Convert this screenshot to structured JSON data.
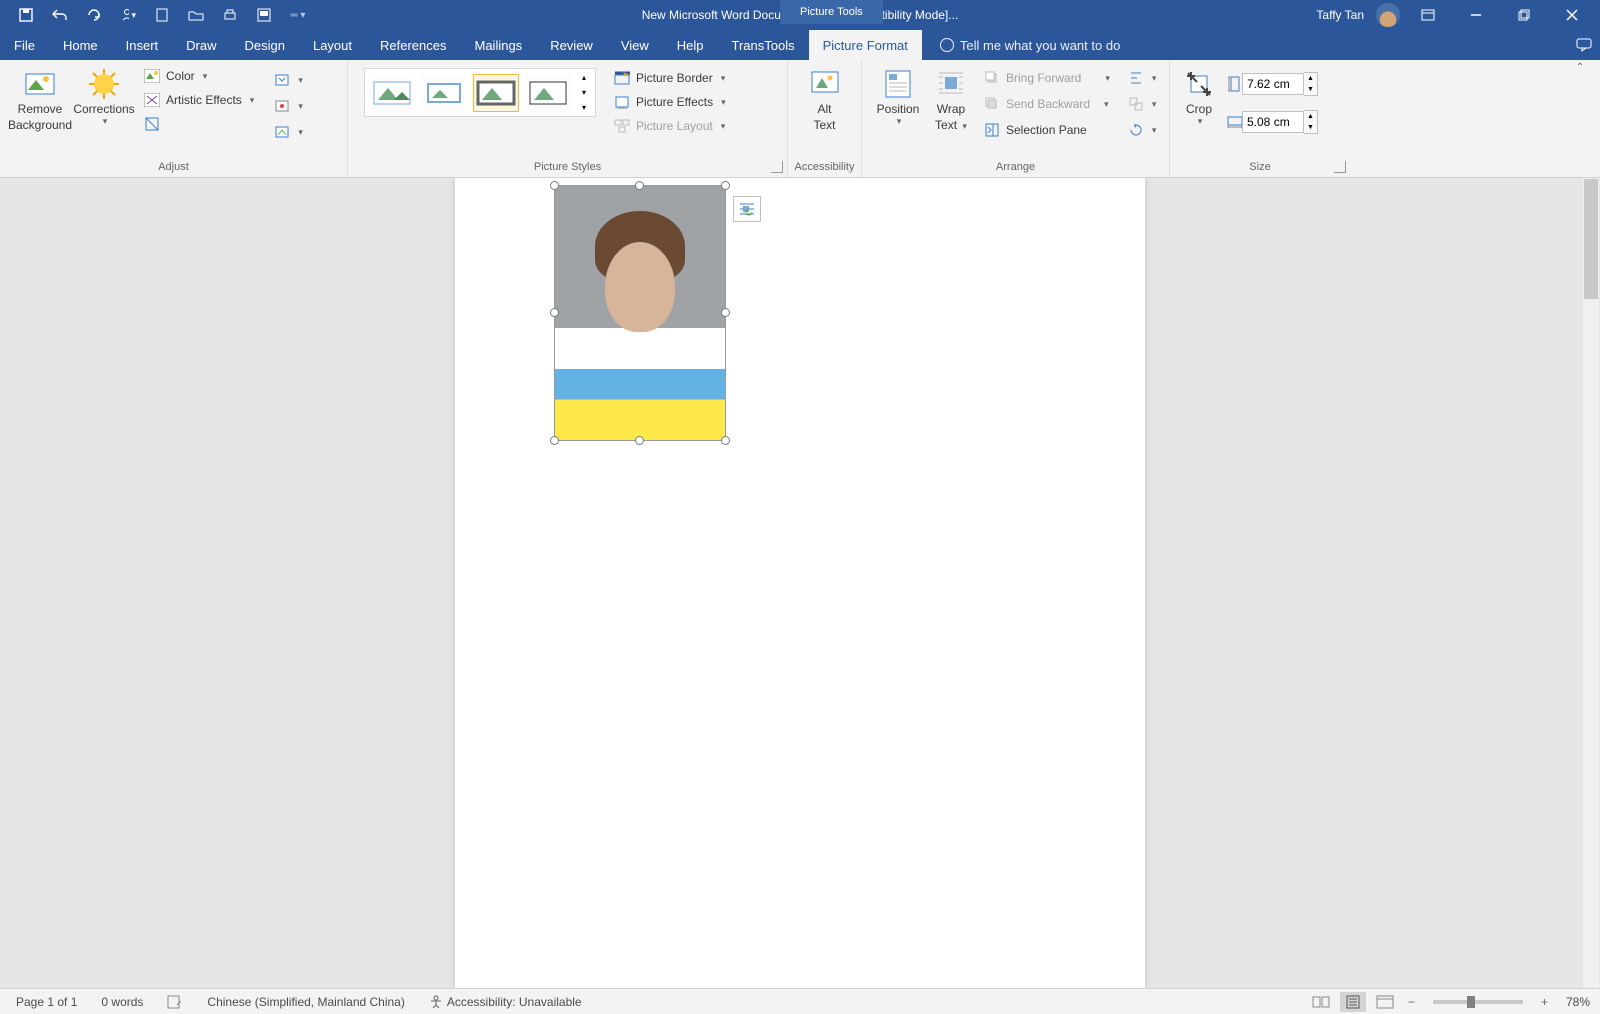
{
  "title_bar": {
    "document_title": "New Microsoft Word Document.docx [Compatibility Mode]...",
    "context_tab": "Picture Tools",
    "user_name": "Taffy Tan"
  },
  "tabs": {
    "file": "File",
    "home": "Home",
    "insert": "Insert",
    "draw": "Draw",
    "design": "Design",
    "layout": "Layout",
    "references": "References",
    "mailings": "Mailings",
    "review": "Review",
    "view": "View",
    "help": "Help",
    "transtools": "TransTools",
    "picture_format": "Picture Format",
    "tellme": "Tell me what you want to do"
  },
  "ribbon": {
    "remove_bg1": "Remove",
    "remove_bg2": "Background",
    "corrections": "Corrections",
    "color": "Color",
    "artistic": "Artistic Effects",
    "adjust_label": "Adjust",
    "styles_label": "Picture Styles",
    "picture_border": "Picture Border",
    "picture_effects": "Picture Effects",
    "picture_layout": "Picture Layout",
    "alt_text1": "Alt",
    "alt_text2": "Text",
    "accessibility_label": "Accessibility",
    "position": "Position",
    "wrap_text1": "Wrap",
    "wrap_text2": "Text",
    "bring_forward": "Bring Forward",
    "send_backward": "Send Backward",
    "selection_pane": "Selection Pane",
    "arrange_label": "Arrange",
    "crop": "Crop",
    "height": "7.62 cm",
    "width": "5.08 cm",
    "size_label": "Size"
  },
  "status": {
    "page": "Page 1 of 1",
    "words": "0 words",
    "language": "Chinese (Simplified, Mainland China)",
    "accessibility": "Accessibility: Unavailable",
    "zoom": "78%"
  }
}
